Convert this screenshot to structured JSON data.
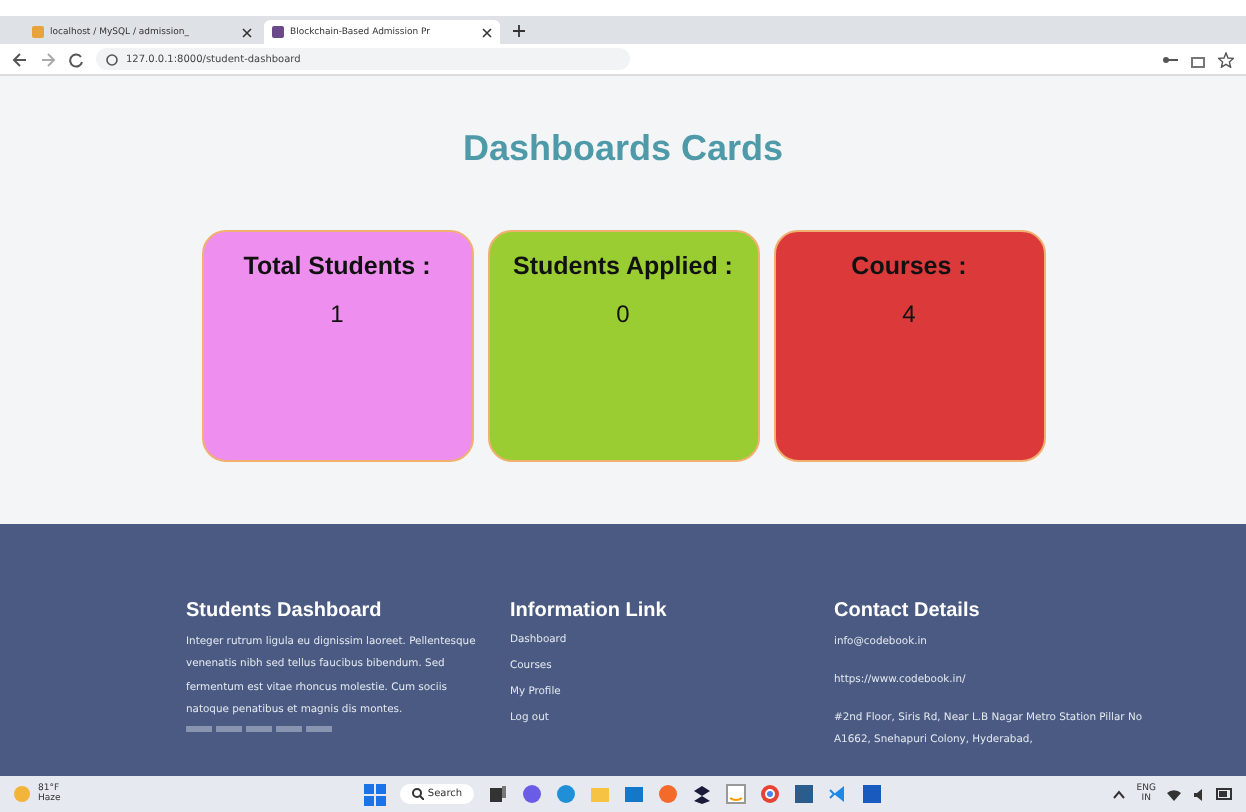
{
  "browser": {
    "tabs": [
      {
        "title": "localhost / MySQL / admission_",
        "selected": false
      },
      {
        "title": "Blockchain-Based Admission Pr",
        "selected": true
      }
    ],
    "url": "127.0.0.1:8000/student-dashboard"
  },
  "page": {
    "heading": "Dashboards Cards",
    "cards": [
      {
        "label": "Total Students :",
        "value": "1",
        "color": "#ee8ff0"
      },
      {
        "label": "Students Applied :",
        "value": "0",
        "color": "#9acd32"
      },
      {
        "label": "Courses :",
        "value": "4",
        "color": "#dc3a3a"
      }
    ]
  },
  "footer": {
    "columns": [
      {
        "title": "Students Dashboard",
        "kind": "text",
        "text": "Integer rutrum ligula eu dignissim laoreet. Pellentesque venenatis nibh sed tellus faucibus bibendum. Sed fermentum est vitae rhoncus molestie. Cum sociis natoque penatibus et magnis dis montes."
      },
      {
        "title": "Information Link",
        "kind": "links",
        "items": [
          "Dashboard",
          "Courses",
          "My Profile",
          "Log out"
        ]
      },
      {
        "title": "Contact Details",
        "kind": "contact",
        "items": [
          "info@codebook.in",
          "https://www.codebook.in/",
          "#2nd Floor, Siris Rd, Near L.B Nagar Metro Station Pillar No A1662, Snehapuri Colony, Hyderabad,"
        ]
      }
    ]
  },
  "taskbar": {
    "weather": {
      "temp": "81°F",
      "condition": "Haze"
    },
    "search": "Search",
    "language": "ENG",
    "region": "IN"
  }
}
